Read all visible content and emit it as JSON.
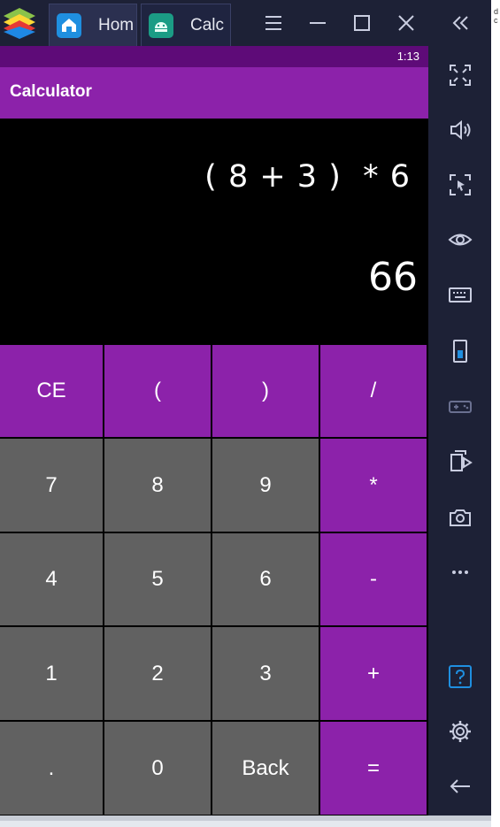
{
  "window": {
    "tabs": [
      {
        "label": "Hom"
      },
      {
        "label": "Calc"
      }
    ],
    "edge_text": [
      "d",
      "c"
    ]
  },
  "status_bar": {
    "time": "1:13"
  },
  "app_bar": {
    "title": "Calculator"
  },
  "display": {
    "expression": "( 8 + 3 )  * 6",
    "result": "66"
  },
  "keypad": {
    "rows": [
      [
        {
          "label": "CE",
          "kind": "op"
        },
        {
          "label": "(",
          "kind": "op"
        },
        {
          "label": ")",
          "kind": "op"
        },
        {
          "label": "/",
          "kind": "op"
        }
      ],
      [
        {
          "label": "7",
          "kind": "num"
        },
        {
          "label": "8",
          "kind": "num"
        },
        {
          "label": "9",
          "kind": "num"
        },
        {
          "label": "*",
          "kind": "op"
        }
      ],
      [
        {
          "label": "4",
          "kind": "num"
        },
        {
          "label": "5",
          "kind": "num"
        },
        {
          "label": "6",
          "kind": "num"
        },
        {
          "label": "-",
          "kind": "op"
        }
      ],
      [
        {
          "label": "1",
          "kind": "num"
        },
        {
          "label": "2",
          "kind": "num"
        },
        {
          "label": "3",
          "kind": "num"
        },
        {
          "label": "+",
          "kind": "op"
        }
      ],
      [
        {
          "label": ".",
          "kind": "num"
        },
        {
          "label": "0",
          "kind": "num"
        },
        {
          "label": "Back",
          "kind": "num"
        },
        {
          "label": "=",
          "kind": "op"
        }
      ]
    ]
  },
  "side_toolbar": {
    "icons": [
      "fullscreen-icon",
      "volume-icon",
      "screen-select-icon",
      "eye-icon",
      "keyboard-icon",
      "phone-icon",
      "gamepad-icon",
      "media-import-icon",
      "camera-icon",
      "more-icon",
      "help-icon",
      "settings-icon",
      "back-arrow-icon"
    ]
  },
  "colors": {
    "accent": "#8c22aa",
    "status_bar": "#5e0b78",
    "number_key": "#616161",
    "chrome": "#1d2136"
  }
}
